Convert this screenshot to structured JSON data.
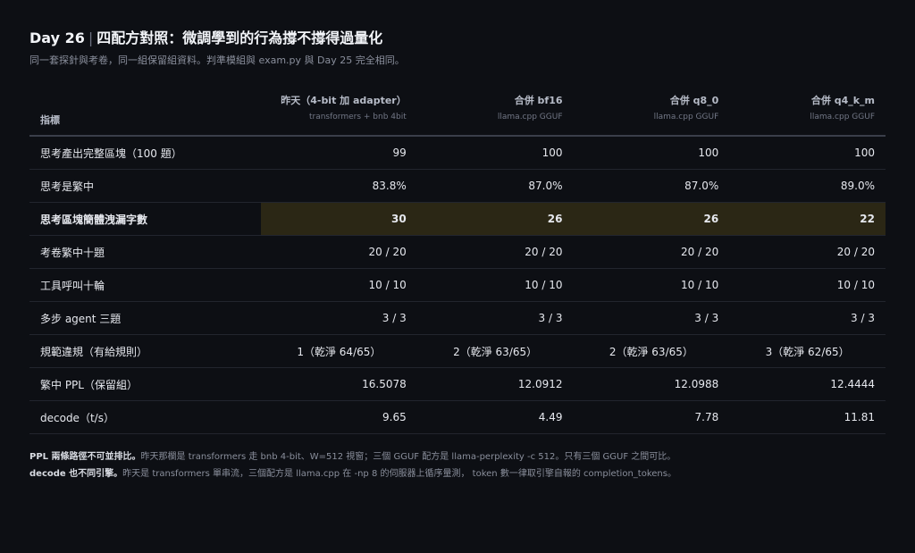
{
  "header": {
    "title_day": "Day 26",
    "title_sep": "|",
    "title_main": "四配方對照：微調學到的行為撐不撐得過量化",
    "subtitle": "同一套探針與考卷，同一組保留組資料。判準模組與 exam.py 與 Day 25 完全相同。"
  },
  "table": {
    "metric_header": "指標",
    "columns": [
      {
        "name": "昨天（4-bit 加 adapter）",
        "sub": "transformers + bnb 4bit"
      },
      {
        "name": "合併 bf16",
        "sub": "llama.cpp GGUF"
      },
      {
        "name": "合併 q8_0",
        "sub": "llama.cpp GGUF"
      },
      {
        "name": "合併 q4_k_m",
        "sub": "llama.cpp GGUF"
      }
    ],
    "rows": [
      {
        "metric": "思考產出完整區塊（100 題）",
        "values": [
          "99",
          "100",
          "100",
          "100"
        ]
      },
      {
        "metric": "思考是繁中",
        "values": [
          "83.8%",
          "87.0%",
          "87.0%",
          "89.0%"
        ]
      },
      {
        "metric": "思考區塊簡體洩漏字數",
        "values": [
          "30",
          "26",
          "26",
          "22"
        ]
      },
      {
        "metric": "考卷繁中十題",
        "values": [
          "20 / 20",
          "20 / 20",
          "20 / 20",
          "20 / 20"
        ]
      },
      {
        "metric": "工具呼叫十輪",
        "values": [
          "10 / 10",
          "10 / 10",
          "10 / 10",
          "10 / 10"
        ]
      },
      {
        "metric": "多步 agent 三題",
        "values": [
          "3 / 3",
          "3 / 3",
          "3 / 3",
          "3 / 3"
        ]
      },
      {
        "metric": "規範違規（有給規則）",
        "values": [
          "1（乾淨 64/65）",
          "2（乾淨 63/65）",
          "2（乾淨 63/65）",
          "3（乾淨 62/65）"
        ]
      },
      {
        "metric": "繁中 PPL（保留組）",
        "values": [
          "16.5078",
          "12.0912",
          "12.0988",
          "12.4444"
        ]
      },
      {
        "metric": "decode（t/s）",
        "values": [
          "9.65",
          "4.49",
          "7.78",
          "11.81"
        ]
      }
    ]
  },
  "notes": {
    "ppl_bold": "PPL 兩條路徑不可並排比。",
    "ppl_text": "昨天那欄是 transformers 走 bnb 4-bit、W=512 視窗；三個 GGUF 配方是 llama-perplexity -c 512。只有三個 GGUF 之間可比。",
    "decode_bold": "decode 也不同引擎。",
    "decode_text": "昨天是 transformers 單串流，三個配方是 llama.cpp 在 -np 8 的伺服器上循序量測， token 數一律取引擎自報的 completion_tokens。"
  },
  "colors": {
    "background": "#0d0f14",
    "highlight_text": "#f0b429",
    "highlight_bg": "#2b2715"
  }
}
